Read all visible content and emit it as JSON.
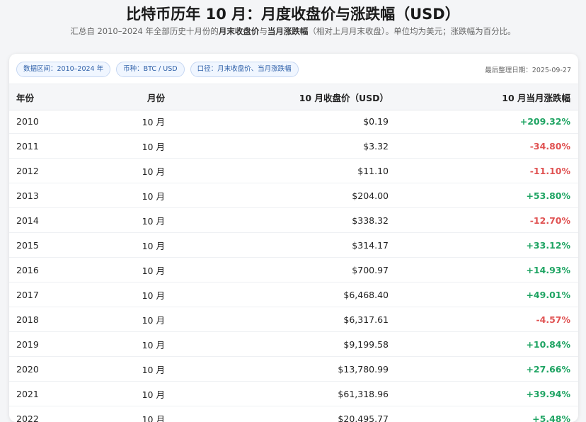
{
  "header": {
    "title": "比特币历年 10 月：月度收盘价与涨跌幅（USD）",
    "subtitle_prefix": "汇总自 2010–2024 年全部历史十月份的",
    "subtitle_bold1": "月末收盘价",
    "subtitle_mid": "与",
    "subtitle_bold2": "当月涨跌幅",
    "subtitle_suffix": "（相对上月月末收盘）。单位均为美元；涨跌幅为百分比。"
  },
  "filters": {
    "range": "数据区间：2010–2024 年",
    "coin": "币种：BTC / USD",
    "basis": "口径：月末收盘价、当月涨跌幅"
  },
  "updated": "最后整理日期：2025-09-27",
  "table": {
    "headers": {
      "year": "年份",
      "month": "月份",
      "close": "10 月收盘价（USD）",
      "change": "10 月当月涨跌幅"
    },
    "rows": [
      {
        "year": "2010",
        "month": "10 月",
        "close": "$0.19",
        "change": "+209.32%",
        "dir": "pos"
      },
      {
        "year": "2011",
        "month": "10 月",
        "close": "$3.32",
        "change": "-34.80%",
        "dir": "neg"
      },
      {
        "year": "2012",
        "month": "10 月",
        "close": "$11.10",
        "change": "-11.10%",
        "dir": "neg"
      },
      {
        "year": "2013",
        "month": "10 月",
        "close": "$204.00",
        "change": "+53.80%",
        "dir": "pos"
      },
      {
        "year": "2014",
        "month": "10 月",
        "close": "$338.32",
        "change": "-12.70%",
        "dir": "neg"
      },
      {
        "year": "2015",
        "month": "10 月",
        "close": "$314.17",
        "change": "+33.12%",
        "dir": "pos"
      },
      {
        "year": "2016",
        "month": "10 月",
        "close": "$700.97",
        "change": "+14.93%",
        "dir": "pos"
      },
      {
        "year": "2017",
        "month": "10 月",
        "close": "$6,468.40",
        "change": "+49.01%",
        "dir": "pos"
      },
      {
        "year": "2018",
        "month": "10 月",
        "close": "$6,317.61",
        "change": "-4.57%",
        "dir": "neg"
      },
      {
        "year": "2019",
        "month": "10 月",
        "close": "$9,199.58",
        "change": "+10.84%",
        "dir": "pos"
      },
      {
        "year": "2020",
        "month": "10 月",
        "close": "$13,780.99",
        "change": "+27.66%",
        "dir": "pos"
      },
      {
        "year": "2021",
        "month": "10 月",
        "close": "$61,318.96",
        "change": "+39.94%",
        "dir": "pos"
      },
      {
        "year": "2022",
        "month": "10 月",
        "close": "$20,495.77",
        "change": "+5.48%",
        "dir": "pos"
      }
    ]
  },
  "colors": {
    "positive": "#1fa463",
    "negative": "#e05252",
    "chip_text": "#2d5fa8"
  }
}
